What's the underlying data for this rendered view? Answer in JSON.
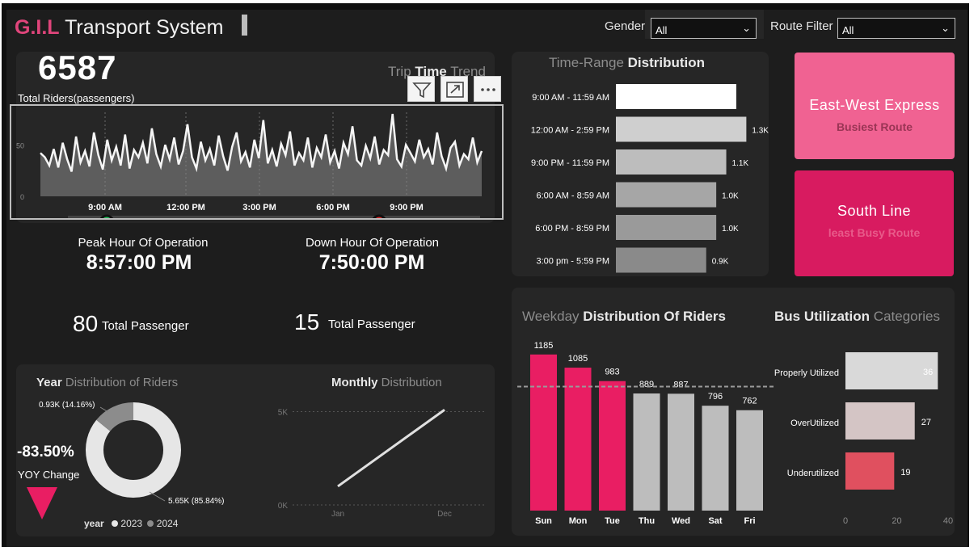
{
  "header": {
    "brand": "G.I.L",
    "title": "Transport System",
    "gender_label": "Gender",
    "gender_value": "All",
    "route_label": "Route Filter",
    "route_value": "All"
  },
  "trip_panel": {
    "total_value": "6587",
    "total_label": "Total Riders(passengers)",
    "title_prefix": "Trip",
    "title_bold": "Time",
    "title_suffix": "Trend",
    "y_ticks": [
      "50",
      "0"
    ],
    "x_ticks": [
      "9:00 AM",
      "12:00 PM",
      "3:00 PM",
      "6:00 PM",
      "9:00 PM"
    ],
    "visual_actions": [
      "filter-icon",
      "focus-mode-icon",
      "more-options-icon"
    ]
  },
  "peak": {
    "label": "Peak  Hour Of Operation",
    "value": "8:57:00 PM",
    "count": "80",
    "count_label": "Total Passenger",
    "marker_color": "#22c55e"
  },
  "down": {
    "label": "Down Hour Of Operation",
    "value": "7:50:00 PM",
    "count": "15",
    "count_label": "Total Passenger",
    "marker_color": "#dc2626"
  },
  "time_range": {
    "title_prefix": "Time-Range",
    "title_bold": "Distribution"
  },
  "routes": {
    "busiest_name": "East-West Express",
    "busiest_label": "Busiest Route",
    "busiest_color": "#f06292",
    "least_name": "South Line",
    "least_label": "least Busy Route",
    "least_color": "#d81b60"
  },
  "year_panel": {
    "title_bold": "Year",
    "title_rest": "Distribution of Riders",
    "yoy_value": "-83.50%",
    "yoy_label": "YOY Change",
    "legend_title": "year",
    "legend": [
      "2023",
      "2024"
    ],
    "slice_labels": [
      "0.93K (14.16%)",
      "5.65K (85.84%)"
    ]
  },
  "monthly_panel": {
    "title_bold": "Monthly",
    "title_rest": "Distribution",
    "y_ticks": [
      "5K",
      "0K"
    ],
    "x_ticks": [
      "Jan",
      "Dec"
    ]
  },
  "weekday_panel": {
    "title_prefix": "Weekday",
    "title_bold": "Distribution Of Riders"
  },
  "utilization_panel": {
    "title_bold": "Bus Utilization",
    "title_rest": "Categories",
    "x_ticks": [
      "0",
      "20",
      "40"
    ]
  },
  "chart_data": [
    {
      "id": "trip_time_trend",
      "type": "area",
      "x_ticks": [
        "9:00 AM",
        "12:00 PM",
        "3:00 PM",
        "6:00 PM",
        "9:00 PM"
      ],
      "ylim": [
        0,
        80
      ],
      "y_ticks": [
        0,
        50
      ],
      "values": [
        42,
        38,
        30,
        46,
        28,
        52,
        36,
        24,
        58,
        33,
        44,
        29,
        62,
        40,
        26,
        55,
        35,
        48,
        30,
        60,
        27,
        45,
        38,
        52,
        32,
        66,
        41,
        29,
        50,
        36,
        57,
        31,
        44,
        70,
        38,
        27,
        53,
        35,
        46,
        30,
        59,
        39,
        25,
        48,
        62,
        34,
        43,
        28,
        55,
        37,
        74,
        32,
        45,
        29,
        51,
        40,
        63,
        30,
        42,
        35,
        57,
        28,
        47,
        38,
        60,
        33,
        44,
        27,
        52,
        41,
        68,
        35,
        30,
        49,
        37,
        58,
        31,
        45,
        40,
        80,
        36,
        29,
        50,
        42,
        34,
        55,
        38,
        46,
        31,
        62,
        39,
        27,
        47,
        53,
        30,
        41,
        36,
        57,
        33,
        44
      ]
    },
    {
      "id": "time_range_distribution",
      "type": "bar",
      "orientation": "horizontal",
      "categories": [
        "9:00 AM - 11:59 AM",
        "12:00 AM - 2:59 PM",
        "9:00 PM - 11:59 PM",
        "6:00 AM - 8:59 AM",
        "6:00 PM - 8:59 PM",
        "3:00 pm - 5:59 PM"
      ],
      "values": [
        1.2,
        1.3,
        1.1,
        1.0,
        1.0,
        0.9
      ],
      "data_labels": [
        "",
        "1.3K",
        "1.1K",
        "1.0K",
        "1.0K",
        "0.9K"
      ],
      "colors": [
        "#ffffff",
        "#cfcfcf",
        "#bdbdbd",
        "#a6a6a6",
        "#9a9a9a",
        "#8a8a8a"
      ]
    },
    {
      "id": "year_distribution",
      "type": "pie",
      "donut": true,
      "categories": [
        "2023",
        "2024"
      ],
      "values": [
        5650,
        930
      ],
      "data_labels": [
        "5.65K (85.84%)",
        "0.93K (14.16%)"
      ],
      "colors": [
        "#e6e6e6",
        "#8c8c8c"
      ]
    },
    {
      "id": "monthly_distribution",
      "type": "line",
      "x": [
        "Jan",
        "Dec"
      ],
      "values": [
        1000,
        5100
      ],
      "ylim": [
        0,
        5500
      ],
      "y_ticks": [
        "0K",
        "5K"
      ]
    },
    {
      "id": "weekday_distribution",
      "type": "bar",
      "categories": [
        "Sun",
        "Mon",
        "Tue",
        "Thu",
        "Wed",
        "Sat",
        "Fri"
      ],
      "values": [
        1185,
        1085,
        983,
        889,
        887,
        796,
        762
      ],
      "average": 941,
      "ylim": [
        0,
        1300
      ],
      "colors": [
        "#e91e63",
        "#e91e63",
        "#e91e63",
        "#bdbdbd",
        "#bdbdbd",
        "#bdbdbd",
        "#bdbdbd"
      ]
    },
    {
      "id": "bus_utilization",
      "type": "bar",
      "orientation": "horizontal",
      "categories": [
        "Properly Utilized",
        "OverUtilized",
        "Underutilized"
      ],
      "values": [
        36,
        27,
        19
      ],
      "xlim": [
        0,
        40
      ],
      "x_ticks": [
        0,
        20,
        40
      ],
      "colors": [
        "#d9d9d9",
        "#d4c5c5",
        "#e0505f"
      ]
    }
  ]
}
